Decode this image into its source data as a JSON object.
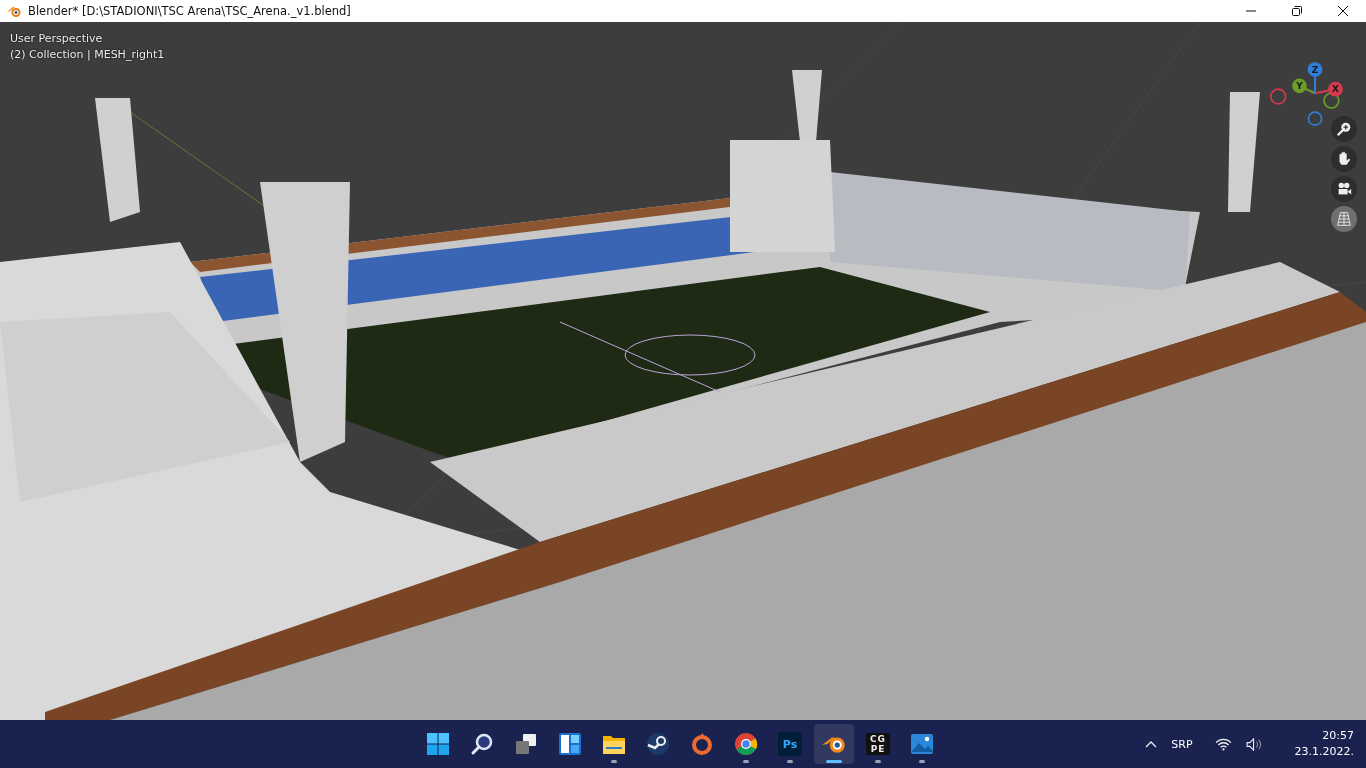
{
  "window": {
    "title": "Blender* [D:\\STADIONI\\TSC Arena\\TSC_Arena._v1.blend]"
  },
  "viewport": {
    "view_name": "User Perspective",
    "object_info": "(2) Collection | MESH_right1",
    "gizmo_axes": [
      {
        "kind": "neg-x",
        "color": "#d9394e"
      },
      {
        "kind": "neg-y",
        "color": "#6a9d2a"
      },
      {
        "kind": "neg-z",
        "color": "#2e7fd9"
      },
      {
        "kind": "y",
        "label": "Y",
        "color": "#6a9d2a"
      },
      {
        "kind": "x",
        "label": "X",
        "color": "#d9394e"
      },
      {
        "kind": "z",
        "label": "Z",
        "color": "#2e7fd9"
      }
    ],
    "nav_buttons": [
      {
        "kind": "zoom"
      },
      {
        "kind": "pan"
      },
      {
        "kind": "camera"
      },
      {
        "kind": "perspective"
      }
    ]
  },
  "taskbar": {
    "apps": [
      {
        "kind": "start",
        "running": false,
        "selected": false
      },
      {
        "kind": "search",
        "running": false,
        "selected": false
      },
      {
        "kind": "taskview",
        "running": false,
        "selected": false
      },
      {
        "kind": "widgets",
        "running": false,
        "selected": false
      },
      {
        "kind": "folder",
        "running": true,
        "selected": false
      },
      {
        "kind": "steam",
        "running": false,
        "selected": false
      },
      {
        "kind": "origin",
        "running": false,
        "selected": false
      },
      {
        "kind": "chrome",
        "running": true,
        "selected": false
      },
      {
        "kind": "photoshop",
        "label": "Ps",
        "running": true,
        "selected": false
      },
      {
        "kind": "blender",
        "running": true,
        "selected": true
      },
      {
        "kind": "cgpe",
        "label": "CG PE",
        "running": true,
        "selected": false
      },
      {
        "kind": "photos",
        "running": true,
        "selected": false
      }
    ],
    "language": "SRP",
    "time": "20:57",
    "date": "23.1.2022."
  }
}
